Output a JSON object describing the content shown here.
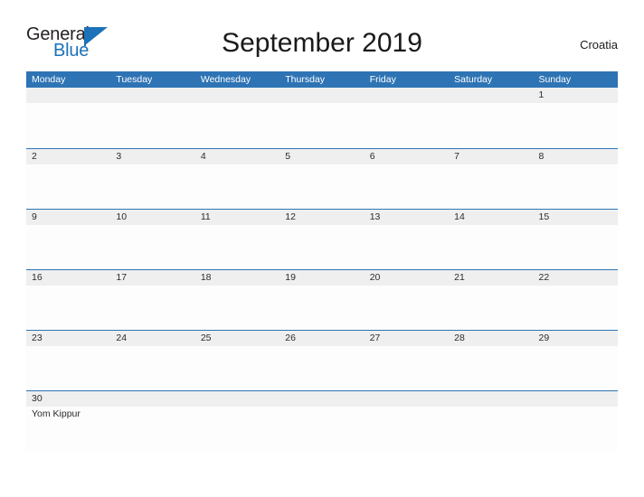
{
  "brand": {
    "name_part1": "General",
    "name_part2": "Blue",
    "flag_color": "#1b72b8"
  },
  "header": {
    "title": "September 2019",
    "country": "Croatia"
  },
  "theme": {
    "header_blue": "#2e74b5",
    "band_gray": "#efefef",
    "text_dark": "#2b2b2b"
  },
  "calendar": {
    "weekdays": [
      "Monday",
      "Tuesday",
      "Wednesday",
      "Thursday",
      "Friday",
      "Saturday",
      "Sunday"
    ],
    "weeks": [
      [
        {
          "day": "",
          "events": []
        },
        {
          "day": "",
          "events": []
        },
        {
          "day": "",
          "events": []
        },
        {
          "day": "",
          "events": []
        },
        {
          "day": "",
          "events": []
        },
        {
          "day": "",
          "events": []
        },
        {
          "day": "1",
          "events": []
        }
      ],
      [
        {
          "day": "2",
          "events": []
        },
        {
          "day": "3",
          "events": []
        },
        {
          "day": "4",
          "events": []
        },
        {
          "day": "5",
          "events": []
        },
        {
          "day": "6",
          "events": []
        },
        {
          "day": "7",
          "events": []
        },
        {
          "day": "8",
          "events": []
        }
      ],
      [
        {
          "day": "9",
          "events": []
        },
        {
          "day": "10",
          "events": []
        },
        {
          "day": "11",
          "events": []
        },
        {
          "day": "12",
          "events": []
        },
        {
          "day": "13",
          "events": []
        },
        {
          "day": "14",
          "events": []
        },
        {
          "day": "15",
          "events": []
        }
      ],
      [
        {
          "day": "16",
          "events": []
        },
        {
          "day": "17",
          "events": []
        },
        {
          "day": "18",
          "events": []
        },
        {
          "day": "19",
          "events": []
        },
        {
          "day": "20",
          "events": []
        },
        {
          "day": "21",
          "events": []
        },
        {
          "day": "22",
          "events": []
        }
      ],
      [
        {
          "day": "23",
          "events": []
        },
        {
          "day": "24",
          "events": []
        },
        {
          "day": "25",
          "events": []
        },
        {
          "day": "26",
          "events": []
        },
        {
          "day": "27",
          "events": []
        },
        {
          "day": "28",
          "events": []
        },
        {
          "day": "29",
          "events": []
        }
      ],
      [
        {
          "day": "30",
          "events": [
            "Yom Kippur"
          ]
        },
        {
          "day": "",
          "events": []
        },
        {
          "day": "",
          "events": []
        },
        {
          "day": "",
          "events": []
        },
        {
          "day": "",
          "events": []
        },
        {
          "day": "",
          "events": []
        },
        {
          "day": "",
          "events": []
        }
      ]
    ]
  }
}
